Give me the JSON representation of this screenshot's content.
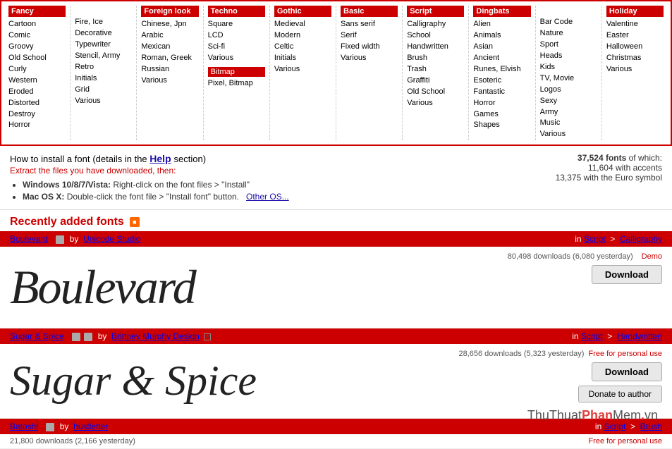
{
  "nav": {
    "columns": [
      {
        "header": "Fancy",
        "links": [
          "Cartoon",
          "Comic",
          "Groovy",
          "Old School",
          "Curly",
          "Western",
          "Eroded",
          "Distorted",
          "Destroy",
          "Horror"
        ]
      },
      {
        "header": "",
        "links": [
          "Fire, Ice",
          "Decorative",
          "Typewriter",
          "Stencil, Army",
          "Retro",
          "Initials",
          "Grid",
          "Various"
        ]
      },
      {
        "header": "Foreign look",
        "links": [
          "Chinese, Jpn",
          "Arabic",
          "Mexican",
          "Roman, Greek",
          "Russian",
          "Various"
        ]
      },
      {
        "header": "Techno",
        "links": [
          "Square",
          "LCD",
          "Sci-fi",
          "Various"
        ],
        "sub_header": "Bitmap",
        "sub_links": [
          "Pixel, Bitmap"
        ]
      },
      {
        "header": "Gothic",
        "links": [
          "Medieval",
          "Modern",
          "Celtic",
          "Initials",
          "Various"
        ]
      },
      {
        "header": "Basic",
        "links": [
          "Sans serif",
          "Serif",
          "Fixed width",
          "Various"
        ]
      },
      {
        "header": "Script",
        "links": [
          "Calligraphy",
          "School",
          "Handwritten",
          "Brush",
          "Trash",
          "Graffiti",
          "Old School",
          "Various"
        ]
      },
      {
        "header": "Dingbats",
        "links": [
          "Alien",
          "Animals",
          "Asian",
          "Ancient",
          "Runes, Elvish",
          "Esoteric",
          "Fantastic",
          "Horror",
          "Games",
          "Shapes"
        ]
      },
      {
        "header": "",
        "links": [
          "Bar Code",
          "Nature",
          "Sport",
          "Heads",
          "Kids",
          "TV, Movie",
          "Logos",
          "Sexy",
          "Army",
          "Music",
          "Various"
        ]
      },
      {
        "header": "Holiday",
        "links": [
          "Valentine",
          "Easter",
          "Halloween",
          "Christmas",
          "Various"
        ]
      }
    ]
  },
  "install": {
    "title": "How to install a font",
    "detail_text": "(details in the ",
    "help_link": "Help",
    "detail_end": " section)",
    "extract_text": "Extract the files you have downloaded, then:",
    "steps": [
      "Windows 10/8/7/Vista: Right-click on the font files > \"Install\"",
      "Mac OS X: Double-click the font file > \"Install font\" button."
    ],
    "other_os": "Other OS...",
    "stats": {
      "total": "37,524 fonts",
      "total_suffix": " of which:",
      "accents": "11,604 with accents",
      "euro": "13,375 with the Euro symbol"
    }
  },
  "recently_added": {
    "title": "Recently added fonts"
  },
  "fonts": [
    {
      "id": "boulevard",
      "name": "Boulevard",
      "author": "Unicode Studio",
      "category": "Script",
      "subcategory": "Calligraphy",
      "downloads": "80,498 downloads (6,080 yesterday)",
      "demo_label": "Demo",
      "download_label": "Download",
      "preview_text": "Boulevard",
      "has_icons": true,
      "free_label": ""
    },
    {
      "id": "sugar-spice",
      "name": "Sugar & Spice",
      "author": "Brittney Murphy Design",
      "category": "Script",
      "subcategory": "Handwritten",
      "downloads": "28,656 downloads (5,323 yesterday)",
      "free_label": "Free for personal use",
      "download_label": "Download",
      "donate_label": "Donate to author",
      "preview_text": "Sugar & Spice",
      "has_icons": true,
      "has_ext_link": true
    },
    {
      "id": "batoshi",
      "name": "Batoshi",
      "author": "hustletter",
      "category": "Script",
      "subcategory": "Brush",
      "downloads": "21,800 downloads (2,166 yesterday)",
      "free_label": "Free for personal use",
      "preview_text": ""
    }
  ],
  "watermark": {
    "parts": [
      "Thu",
      "Thuat",
      "Phan",
      "Mem",
      ".",
      "vn"
    ]
  }
}
